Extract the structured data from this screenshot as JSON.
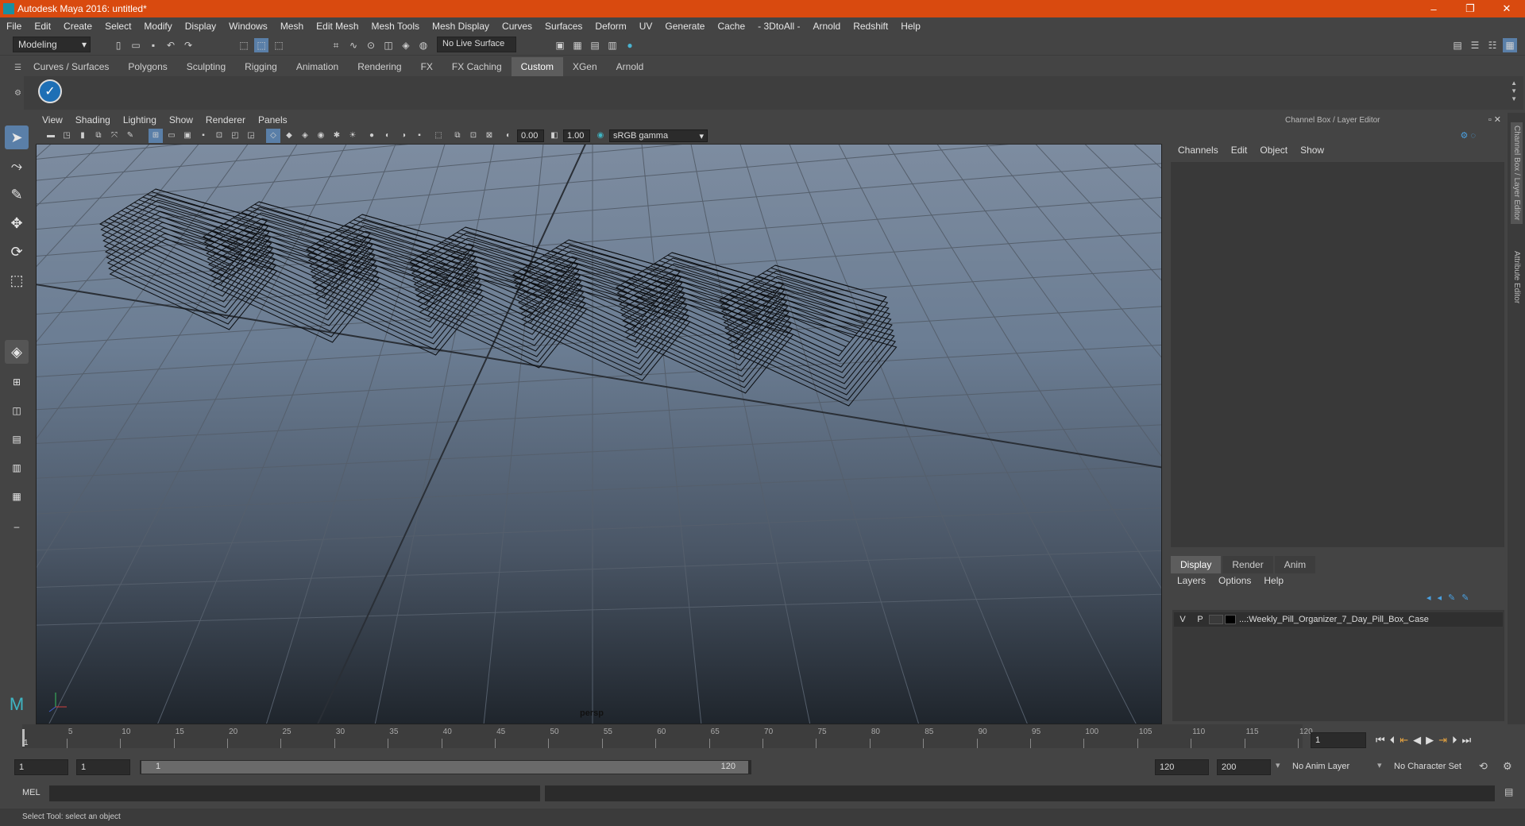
{
  "title": "Autodesk Maya 2016: untitled*",
  "menu": [
    "File",
    "Edit",
    "Create",
    "Select",
    "Modify",
    "Display",
    "Windows",
    "Mesh",
    "Edit Mesh",
    "Mesh Tools",
    "Mesh Display",
    "Curves",
    "Surfaces",
    "Deform",
    "UV",
    "Generate",
    "Cache",
    "- 3DtoAll -",
    "Arnold",
    "Redshift",
    "Help"
  ],
  "status": {
    "mode": "Modeling",
    "live_surface": "No Live Surface"
  },
  "shelf_tabs": [
    "Curves / Surfaces",
    "Polygons",
    "Sculpting",
    "Rigging",
    "Animation",
    "Rendering",
    "FX",
    "FX Caching",
    "Custom",
    "XGen",
    "Arnold"
  ],
  "active_shelf": "Custom",
  "panel_menu": [
    "View",
    "Shading",
    "Lighting",
    "Show",
    "Renderer",
    "Panels"
  ],
  "viewport": {
    "exposure": "0.00",
    "gamma": "1.00",
    "colorspace": "sRGB gamma",
    "camera": "persp"
  },
  "channel_box": {
    "title": "Channel Box / Layer Editor",
    "menu": [
      "Channels",
      "Edit",
      "Object",
      "Show"
    ]
  },
  "layer_editor": {
    "tabs": [
      "Display",
      "Render",
      "Anim"
    ],
    "active": "Display",
    "menu": [
      "Layers",
      "Options",
      "Help"
    ],
    "row": {
      "v": "V",
      "p": "P",
      "name": "...:Weekly_Pill_Organizer_7_Day_Pill_Box_Case"
    }
  },
  "side_tabs": [
    "Channel Box / Layer Editor",
    "Attribute Editor"
  ],
  "timeline": {
    "ticks": [
      "5",
      "10",
      "15",
      "20",
      "25",
      "30",
      "35",
      "40",
      "45",
      "50",
      "55",
      "60",
      "65",
      "70",
      "75",
      "80",
      "85",
      "90",
      "95",
      "100",
      "105",
      "110",
      "115",
      "120"
    ],
    "start_label": "1",
    "current": "1"
  },
  "range": {
    "start": "1",
    "start2": "1",
    "slider_start": "1",
    "slider_end": "120",
    "end": "120",
    "end2": "200",
    "anim_layer": "No Anim Layer",
    "char_set": "No Character Set"
  },
  "cmd": {
    "label": "MEL"
  },
  "help": "Select Tool: select an object"
}
